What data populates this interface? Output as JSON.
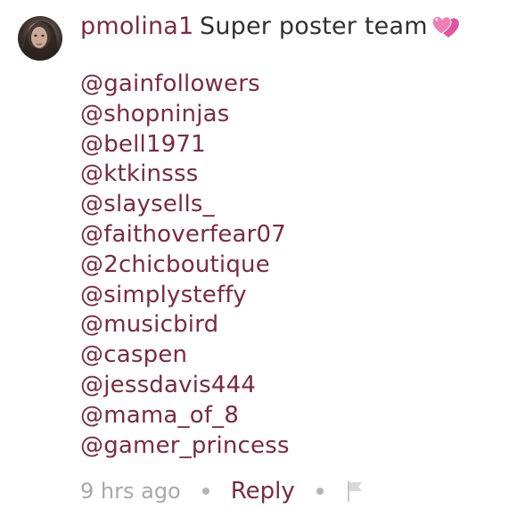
{
  "comment": {
    "username": "pmolina1",
    "message": "Super poster team",
    "emoji": "heart-emoji",
    "mentions": [
      "@gainfollowers",
      "@shopninjas",
      "@bell1971",
      "@ktkinsss",
      "@slaysells_",
      "@faithoverfear07",
      "@2chicboutique",
      "@simplysteffy",
      "@musicbird",
      "@caspen",
      "@jessdavis444",
      "@mama_of_8",
      "@gamer_princess"
    ],
    "timestamp": "9 hrs ago",
    "reply_label": "Reply",
    "flag_icon": "flag-icon"
  },
  "colors": {
    "username": "#7a2b40",
    "mention": "#7a2b40",
    "text": "#303030",
    "muted": "#a8a8a8",
    "heart": "#e0559d"
  }
}
